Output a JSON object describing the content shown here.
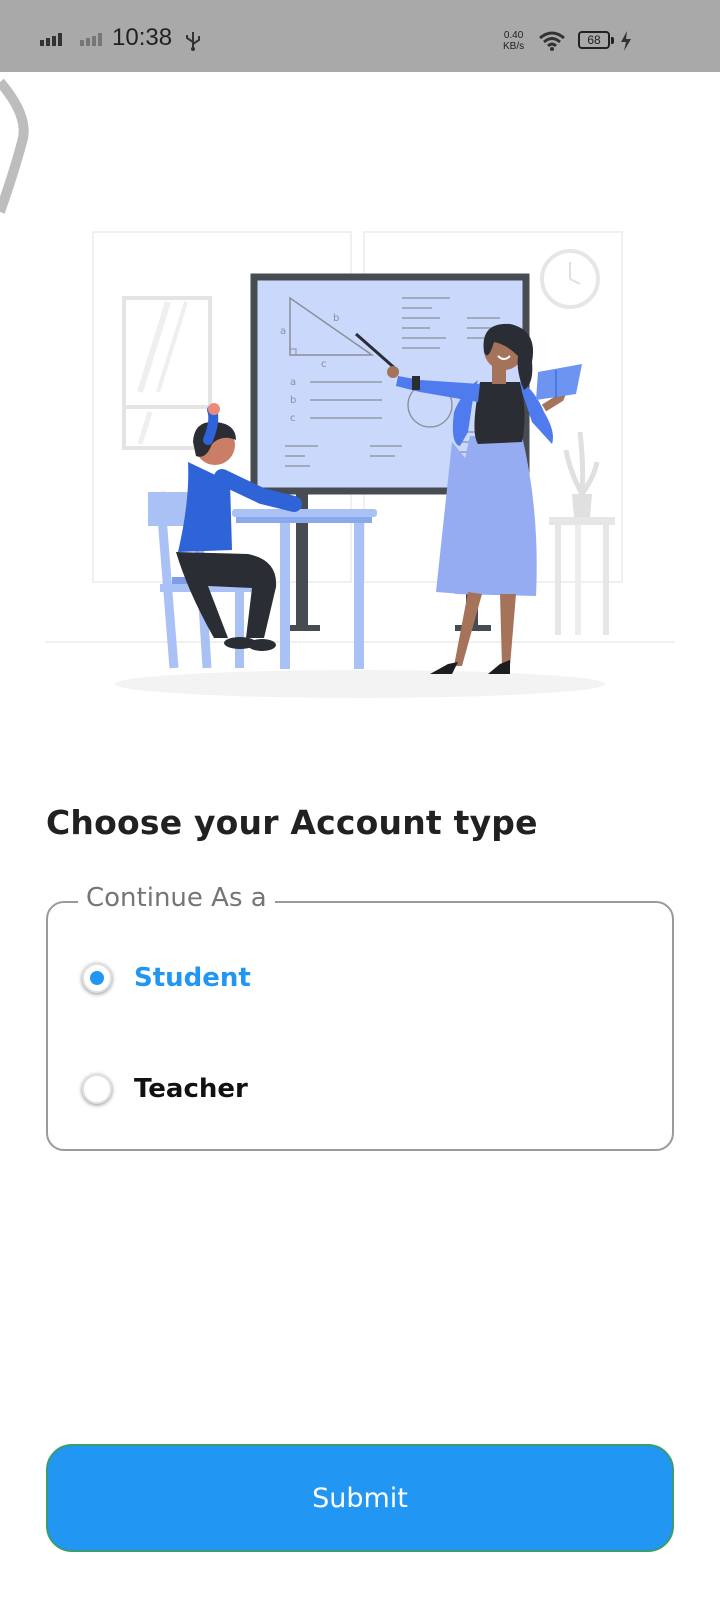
{
  "status_bar": {
    "time": "10:38",
    "speed_value": "0.40",
    "speed_unit": "KB/s",
    "battery": "68",
    "icons": [
      "signal-icon",
      "signal-weak-icon",
      "usb-icon",
      "wifi-icon",
      "battery-icon",
      "charging-icon"
    ]
  },
  "page": {
    "title": "Choose your Account type",
    "group_legend": "Continue As a",
    "options": [
      {
        "label": "Student",
        "selected": true
      },
      {
        "label": "Teacher",
        "selected": false
      }
    ],
    "submit_label": "Submit"
  },
  "illustration": {
    "board_labels": [
      "a",
      "b",
      "c",
      "a",
      "b",
      "c"
    ]
  },
  "colors": {
    "accent": "#2196f3",
    "title": "#212121",
    "legend": "#757575",
    "status_bar": "#a9a9a9"
  }
}
